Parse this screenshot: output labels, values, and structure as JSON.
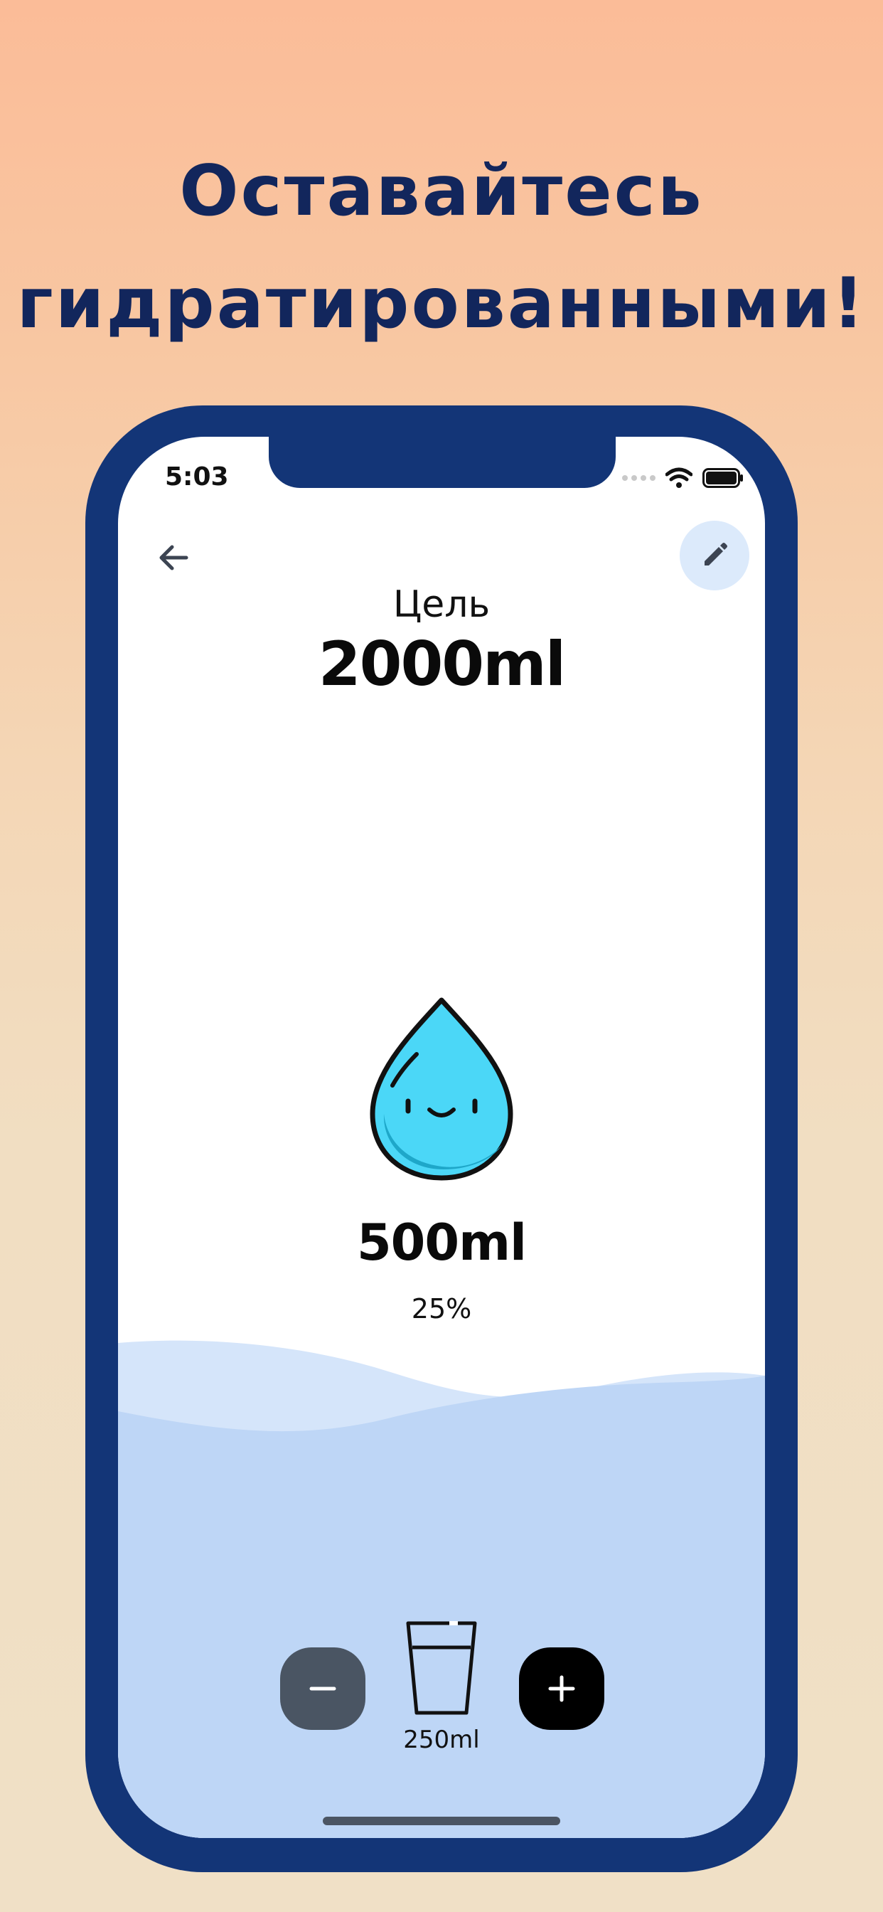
{
  "promo": {
    "headline_line1": "Оставайтесь",
    "headline_line2": "гидратированными!"
  },
  "status_bar": {
    "time": "5:03",
    "icons": [
      "signal-icon",
      "wifi-icon",
      "battery-icon"
    ]
  },
  "toolbar": {
    "back_icon": "arrow-left-icon",
    "edit_icon": "pencil-icon"
  },
  "goal": {
    "label": "Цель",
    "value": "2000ml"
  },
  "progress": {
    "value": "500ml",
    "percent": "25%",
    "fraction": 0.25
  },
  "controls": {
    "decrease_icon": "minus-icon",
    "increase_icon": "plus-icon",
    "serving_icon": "glass-icon",
    "serving_label": "250ml"
  },
  "colors": {
    "background_top": "#FBBC98",
    "background_bottom": "#F0E0C6",
    "headline": "#12265C",
    "phone_frame": "#133577",
    "edit_button_bg": "#DCEAFB",
    "drop": "#4BD7F7",
    "water_light": "#D5E5FA",
    "water": "#BED6F6",
    "minus_button": "#4A5563",
    "plus_button": "#000000"
  }
}
